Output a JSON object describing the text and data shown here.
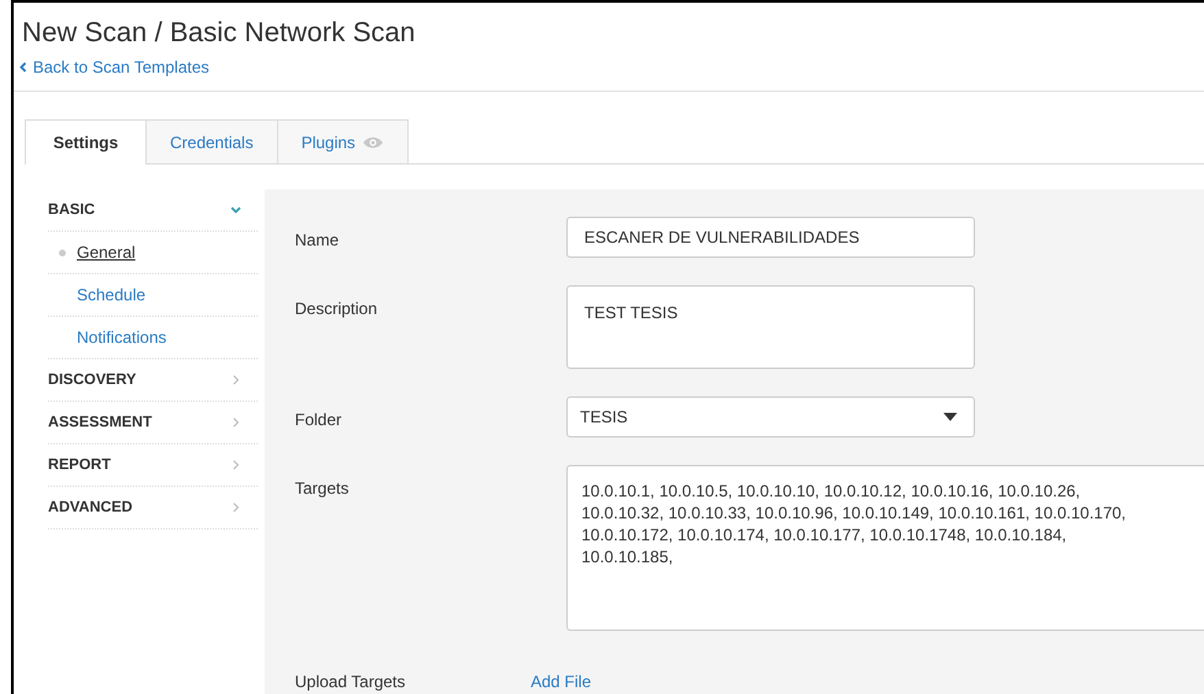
{
  "title": "New Scan / Basic Network Scan",
  "back_link": "Back to Scan Templates",
  "tabs": [
    {
      "label": "Settings",
      "selected": true,
      "icon": false
    },
    {
      "label": "Credentials",
      "selected": false,
      "icon": false
    },
    {
      "label": "Plugins",
      "selected": false,
      "icon": true
    }
  ],
  "sidebar": [
    {
      "label": "BASIC",
      "expanded": true,
      "children": [
        {
          "label": "General",
          "selected": true
        },
        {
          "label": "Schedule",
          "selected": false
        },
        {
          "label": "Notifications",
          "selected": false
        }
      ]
    },
    {
      "label": "DISCOVERY",
      "expanded": false
    },
    {
      "label": "ASSESSMENT",
      "expanded": false
    },
    {
      "label": "REPORT",
      "expanded": false
    },
    {
      "label": "ADVANCED",
      "expanded": false
    }
  ],
  "form": [
    {
      "kind": "input",
      "label": "Name",
      "value": "ESCANER DE VULNERABILIDADES"
    },
    {
      "kind": "textarea",
      "label": "Description",
      "value": "TEST TESIS"
    },
    {
      "kind": "select",
      "label": "Folder",
      "value": "TESIS"
    },
    {
      "kind": "targets",
      "label": "Targets",
      "value": "10.0.10.1, 10.0.10.5, 10.0.10.10, 10.0.10.12, 10.0.10.16, 10.0.10.26, 10.0.10.32, 10.0.10.33, 10.0.10.96, 10.0.10.149, 10.0.10.161, 10.0.10.170, 10.0.10.172, 10.0.10.174, 10.0.10.177, 10.0.10.1748, 10.0.10.184, 10.0.10.185,"
    },
    {
      "kind": "link",
      "label": "Upload Targets",
      "value": "Add File"
    }
  ]
}
